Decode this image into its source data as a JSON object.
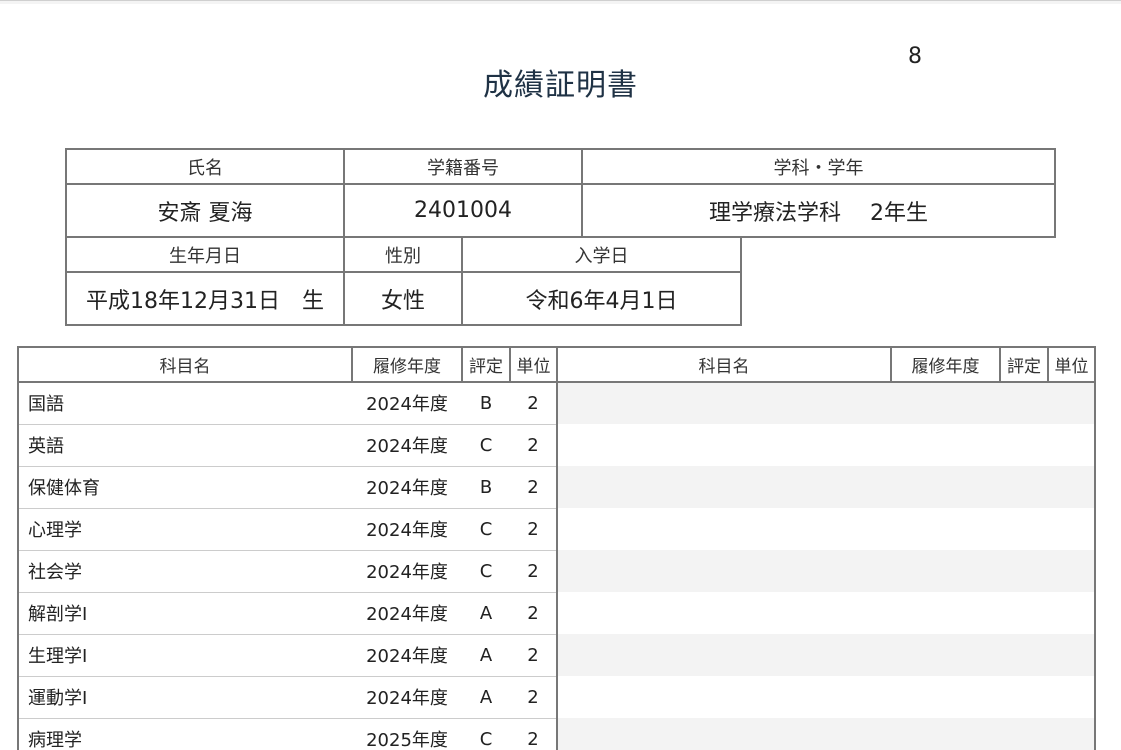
{
  "page_number": "8",
  "title": "成績証明書",
  "student": {
    "name_label": "氏名",
    "name": "安斎 夏海",
    "id_label": "学籍番号",
    "id": "2401004",
    "dept_label": "学科・学年",
    "dept": "理学療法学科　 2年生",
    "birth_label": "生年月日",
    "birth": "平成18年12月31日　生",
    "sex_label": "性別",
    "sex": "女性",
    "enroll_label": "入学日",
    "enroll": "令和6年4月1日"
  },
  "grades": {
    "headers": [
      "科目名",
      "履修年度",
      "評定",
      "単位",
      "科目名",
      "履修年度",
      "評定",
      "単位"
    ],
    "rows": [
      {
        "subject": "国語",
        "year": "2024年度",
        "grade": "B",
        "credits": "2"
      },
      {
        "subject": "英語",
        "year": "2024年度",
        "grade": "C",
        "credits": "2"
      },
      {
        "subject": "保健体育",
        "year": "2024年度",
        "grade": "B",
        "credits": "2"
      },
      {
        "subject": "心理学",
        "year": "2024年度",
        "grade": "C",
        "credits": "2"
      },
      {
        "subject": "社会学",
        "year": "2024年度",
        "grade": "C",
        "credits": "2"
      },
      {
        "subject": "解剖学Ⅰ",
        "year": "2024年度",
        "grade": "A",
        "credits": "2"
      },
      {
        "subject": "生理学Ⅰ",
        "year": "2024年度",
        "grade": "A",
        "credits": "2"
      },
      {
        "subject": "運動学Ⅰ",
        "year": "2024年度",
        "grade": "A",
        "credits": "2"
      },
      {
        "subject": "病理学",
        "year": "2025年度",
        "grade": "C",
        "credits": "2"
      }
    ]
  }
}
